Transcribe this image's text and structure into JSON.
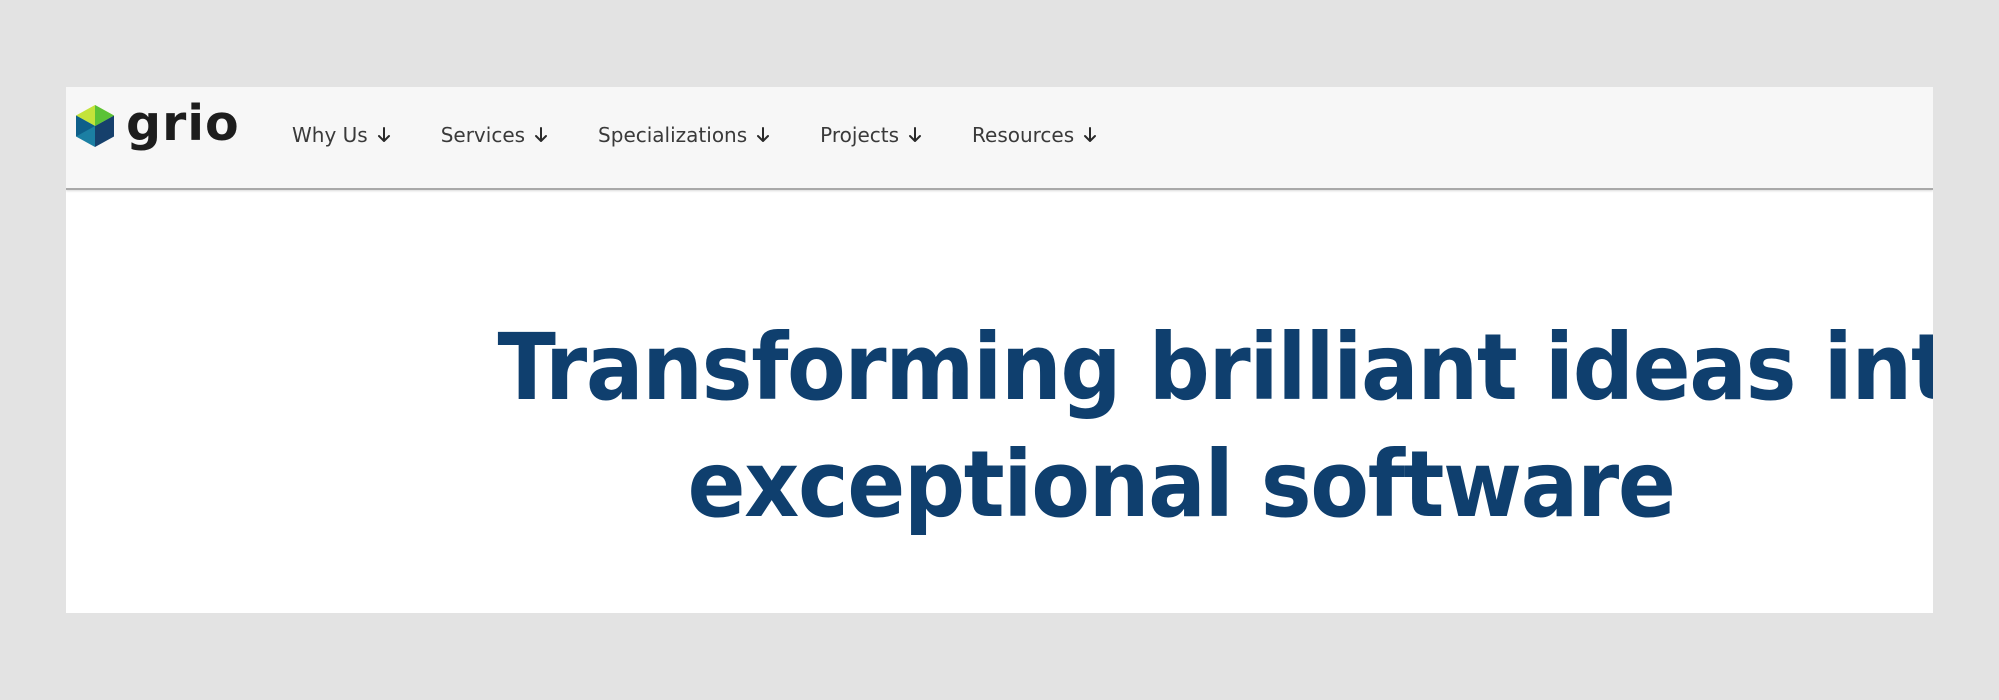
{
  "brand": {
    "name": "grio",
    "logo_colors": [
      "#5bc236",
      "#c4e33a",
      "#1b7fa3",
      "#16406c",
      "#0e5f8a"
    ]
  },
  "nav": {
    "items": [
      {
        "label": "Why Us",
        "icon": "arrow-down-icon"
      },
      {
        "label": "Services",
        "icon": "arrow-down-icon"
      },
      {
        "label": "Specializations",
        "icon": "arrow-down-icon"
      },
      {
        "label": "Projects",
        "icon": "arrow-down-icon"
      },
      {
        "label": "Resources",
        "icon": "arrow-down-icon"
      }
    ]
  },
  "hero": {
    "headline_line1": "Transforming brilliant ideas into",
    "headline_line2": "exceptional software",
    "color": "#0f3f6e"
  }
}
